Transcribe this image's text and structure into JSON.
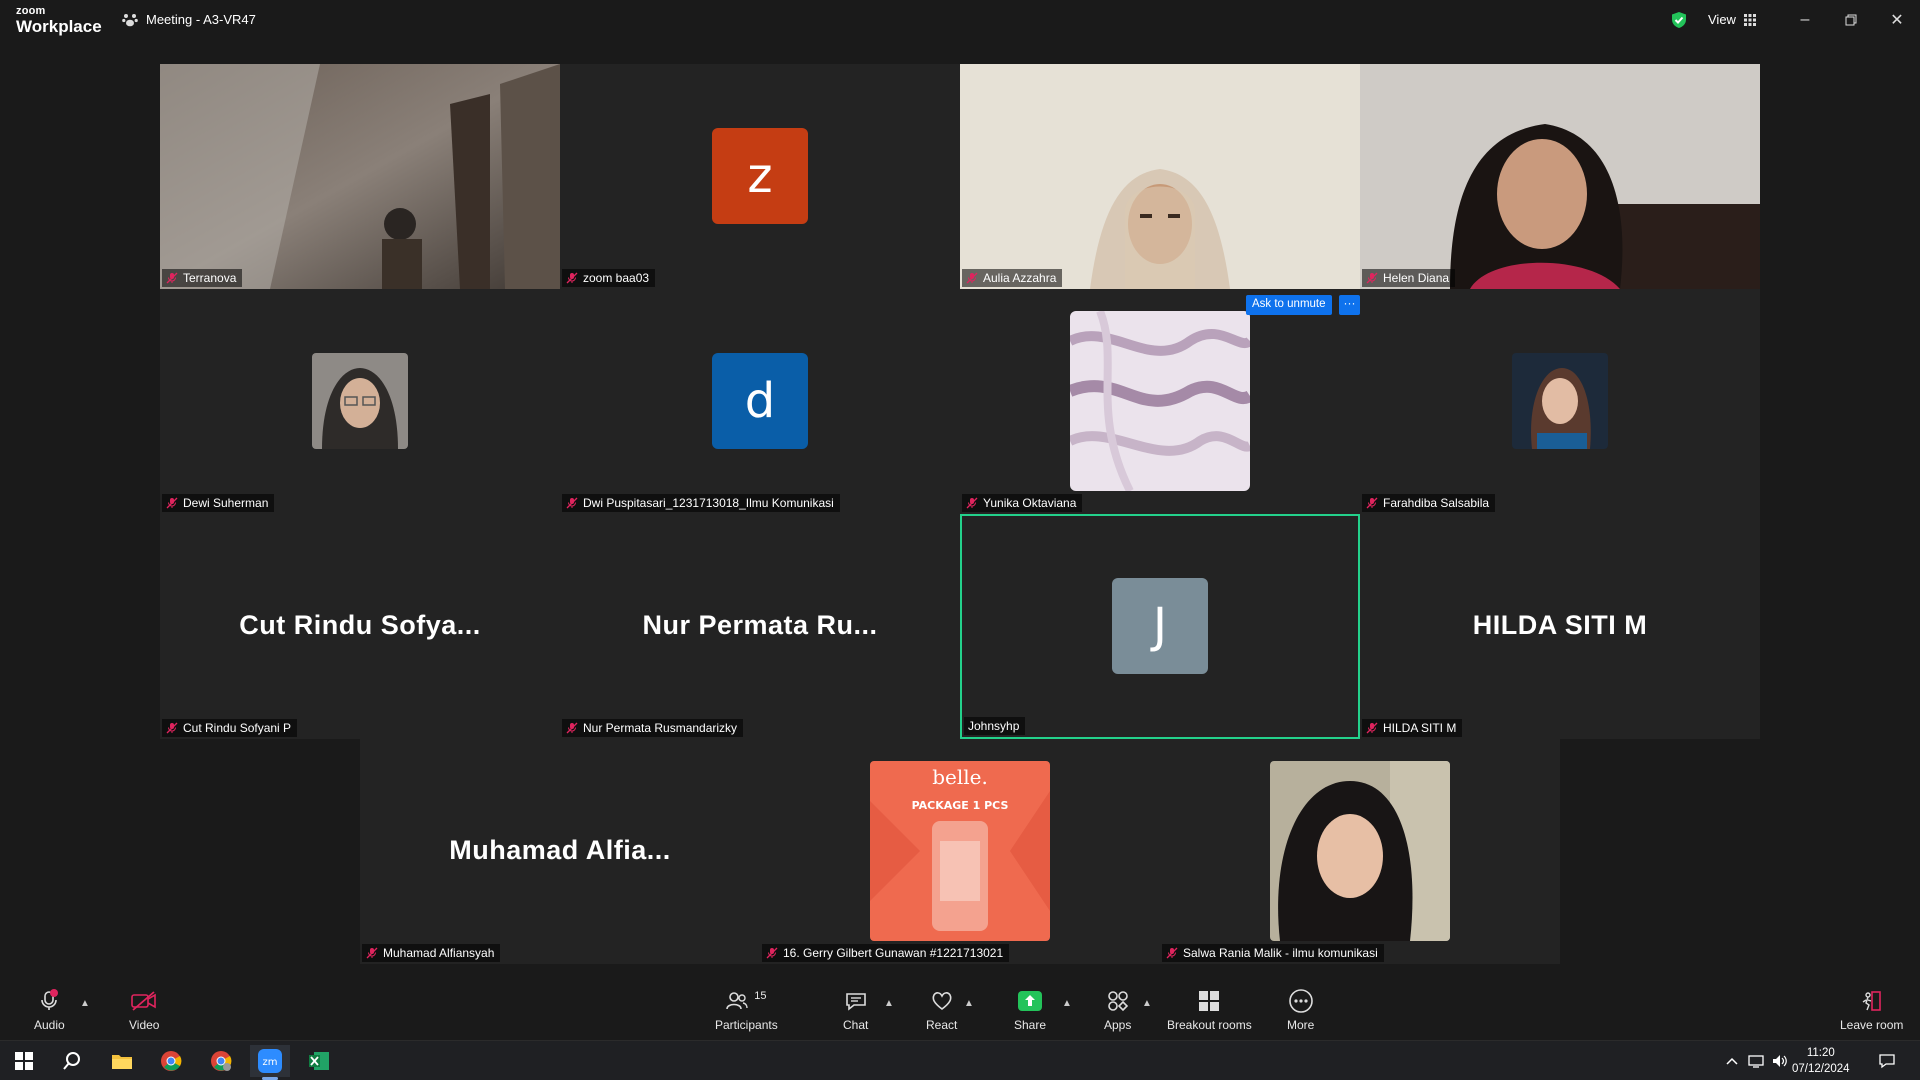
{
  "app": {
    "logo_line1": "zoom",
    "logo_line2": "Workplace",
    "meeting_title": "Meeting - A3-VR47",
    "view_label": "View"
  },
  "participants": [
    {
      "name": "Terranova",
      "display": "video"
    },
    {
      "name": "zoom baa03",
      "display": "letter",
      "letter": "z",
      "color": "#c53d13"
    },
    {
      "name": "Aulia Azzahra",
      "display": "video"
    },
    {
      "name": "Helen Diana",
      "display": "video"
    },
    {
      "name": "Dewi Suherman",
      "display": "photo"
    },
    {
      "name": "Dwi Puspitasari_1231713018_Ilmu Komunikasi",
      "display": "letter",
      "letter": "d",
      "color": "#0a5ea8"
    },
    {
      "name": "Yunika Oktaviana",
      "display": "photo"
    },
    {
      "name": "Farahdiba Salsabila",
      "display": "photo"
    },
    {
      "name": "Cut Rindu Sofyani P",
      "display": "name",
      "big": "Cut Rindu Sofya..."
    },
    {
      "name": "Nur Permata Rusmandarizky",
      "display": "name",
      "big": "Nur Permata Ru..."
    },
    {
      "name": "Johnsyhp",
      "display": "letter",
      "letter": "J",
      "color": "#7a8d98",
      "active_speaker": true
    },
    {
      "name": "HILDA SITI M",
      "display": "name",
      "big": "HILDA SITI M"
    },
    {
      "name": "Muhamad Alfiansyah",
      "display": "name",
      "big": "Muhamad Alfia..."
    },
    {
      "name": "16. Gerry Gilbert Gunawan #1221713021",
      "display": "photo",
      "photo_text1": "belle.",
      "photo_text2": "PACKAGE 1 PCS"
    },
    {
      "name": "Salwa Rania Malik - ilmu komunikasi",
      "display": "photo"
    }
  ],
  "ask_unmute": {
    "label": "Ask to unmute",
    "more": "···"
  },
  "toolbar": {
    "audio": "Audio",
    "video": "Video",
    "participants": "Participants",
    "participants_count": "15",
    "chat": "Chat",
    "react": "React",
    "share": "Share",
    "apps": "Apps",
    "breakout": "Breakout rooms",
    "more": "More",
    "leave": "Leave room"
  },
  "taskbar": {
    "time": "11:20",
    "date": "07/12/2024"
  },
  "colors": {
    "accent_blue": "#0e72ed",
    "active_speaker_border": "#23d18b",
    "share_green": "#23c35a",
    "mic_off_red": "#e0245e"
  }
}
